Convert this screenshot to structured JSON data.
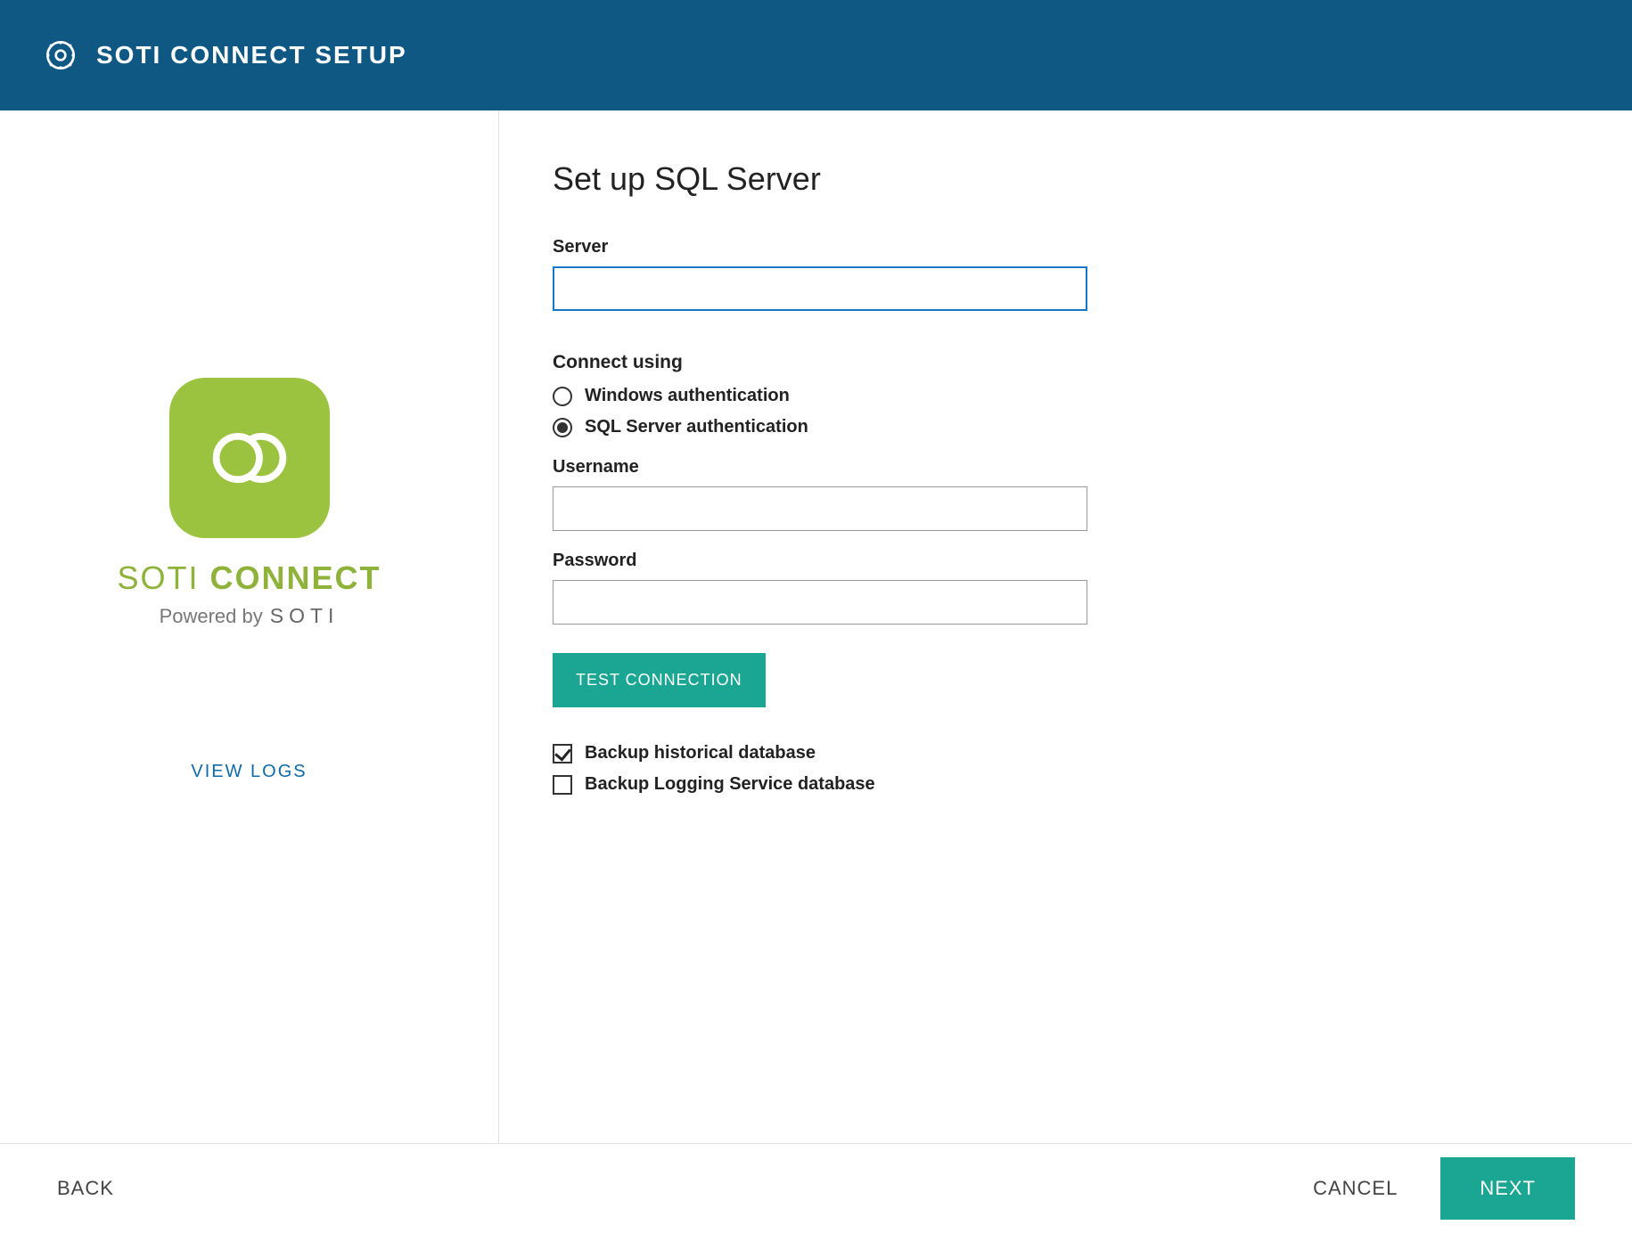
{
  "header": {
    "title": "SOTI CONNECT SETUP",
    "gear_icon": "gear-icon"
  },
  "sidebar": {
    "logo_line1": "SOTI",
    "logo_line2": "CONNECT",
    "powered_prefix": "Powered by",
    "powered_brand": "SOTI",
    "view_logs": "VIEW LOGS"
  },
  "main": {
    "title": "Set up SQL Server",
    "server_label": "Server",
    "server_value": "",
    "connect_label": "Connect using",
    "auth_options": [
      {
        "label": "Windows authentication",
        "selected": false
      },
      {
        "label": "SQL Server authentication",
        "selected": true
      }
    ],
    "username_label": "Username",
    "username_value": "",
    "password_label": "Password",
    "password_value": "",
    "test_button": "TEST CONNECTION",
    "checkboxes": [
      {
        "label": "Backup historical database",
        "checked": true
      },
      {
        "label": "Backup Logging Service database",
        "checked": false
      }
    ]
  },
  "footer": {
    "back": "BACK",
    "cancel": "CANCEL",
    "next": "NEXT"
  }
}
